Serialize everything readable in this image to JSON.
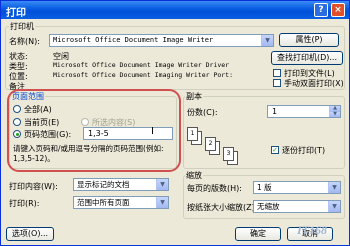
{
  "window": {
    "title": "打印",
    "help_glyph": "?",
    "close_glyph": "×"
  },
  "printer": {
    "group_label": "打印机",
    "name_label": "名称(N):",
    "name_value": "Microsoft Office Document Image Writer",
    "properties_button": "属性(P)",
    "find_printer_button": "查找打印机(D)...",
    "status_label": "状态:",
    "status_value": "空闲",
    "type_label": "类型:",
    "type_value": "Microsoft Office Document Image Writer Driver",
    "location_label": "位置:",
    "location_value": "Microsoft Office Document Imaging Writer Port:",
    "comment_label": "备注",
    "print_to_file_label": "打印到文件(L)",
    "manual_duplex_label": "手动双面打印(X)"
  },
  "page_range": {
    "group_label": "页面范围",
    "all_label": "全部(A)",
    "current_label": "当前页(E)",
    "selection_label": "所选内容(S)",
    "pages_label": "页码范围(G):",
    "pages_value": "1,3-5",
    "hint": "请键入页码和/或用逗号分隔的页码范围(例如: 1,3,5-12)。"
  },
  "copies": {
    "group_label": "副本",
    "count_label": "份数(C):",
    "count_value": "1",
    "collate_label": "逐份打印(T)"
  },
  "print_what": {
    "label": "打印内容(W):",
    "value": "显示标记的文档"
  },
  "print": {
    "label": "打印(R):",
    "value": "范围中所有页面"
  },
  "zoom": {
    "group_label": "缩放",
    "pages_per_sheet_label": "每页的版数(H):",
    "pages_per_sheet_value": "1 版",
    "scale_label": "按纸张大小缩放(Z):",
    "scale_value": "无缩放"
  },
  "footer": {
    "options_button": "选项(O)...",
    "ok_button": "确定",
    "cancel_button": "取消"
  },
  "watermark": "IT168"
}
